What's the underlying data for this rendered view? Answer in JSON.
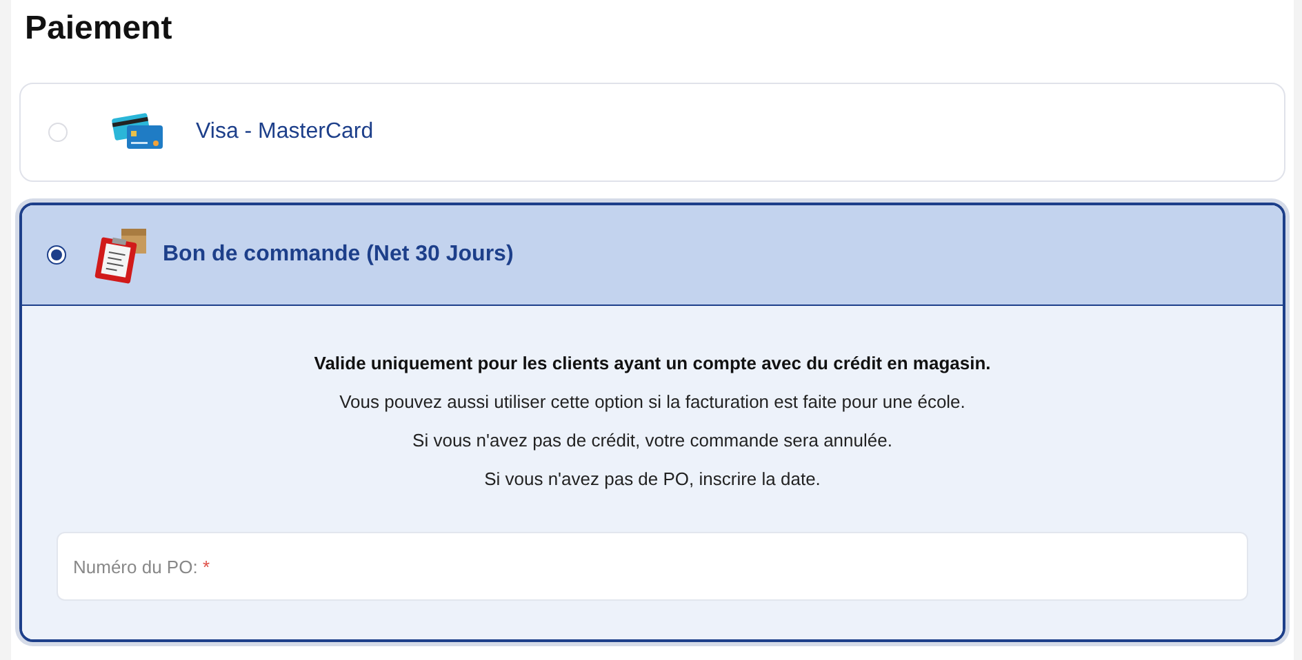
{
  "title": "Paiement",
  "options": [
    {
      "kind": "card",
      "label": "Visa - MasterCard",
      "selected": false
    },
    {
      "kind": "purchase-order",
      "label": "Bon de commande (Net 30 Jours)",
      "selected": true,
      "notes": [
        {
          "text": "Valide uniquement pour les clients ayant un compte avec du crédit en magasin.",
          "bold": true
        },
        {
          "text": "Vous pouvez aussi utiliser cette option si la facturation est faite pour une école.",
          "bold": false
        },
        {
          "text": "Si vous n'avez pas de crédit, votre commande sera annulée.",
          "bold": false
        },
        {
          "text": "Si vous n'avez pas de PO, inscrire la date.",
          "bold": false
        }
      ],
      "field": {
        "label": "Numéro du PO:",
        "required_mark": "*"
      }
    }
  ]
}
